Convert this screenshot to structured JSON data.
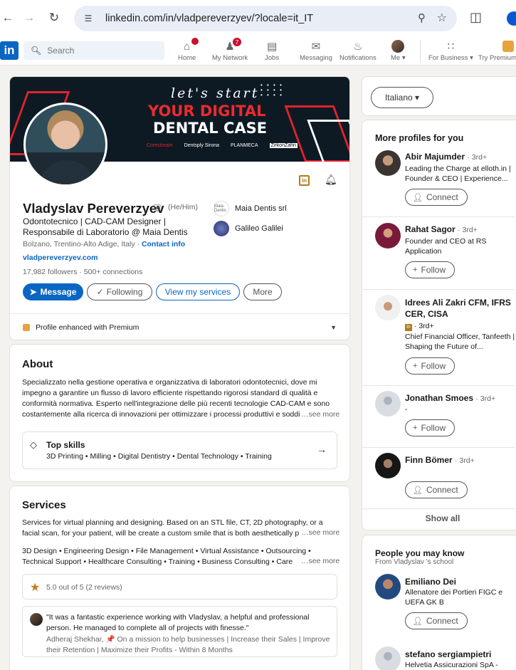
{
  "browser": {
    "url": "linkedin.com/in/vladpereverzyev/?locale=it_IT"
  },
  "nav": {
    "logo": "in",
    "search_placeholder": "Search",
    "items": [
      {
        "label": "Home",
        "badge": ""
      },
      {
        "label": "My Network",
        "badge": "7"
      },
      {
        "label": "Jobs",
        "badge": ""
      },
      {
        "label": "Messaging",
        "badge": ""
      },
      {
        "label": "Notifications",
        "badge": ""
      },
      {
        "label": "Me ▾",
        "badge": ""
      },
      {
        "label": "For Business ▾",
        "badge": ""
      },
      {
        "label": "Try Premium",
        "badge": ""
      }
    ]
  },
  "banner": {
    "tagline": "let's start",
    "title_line1": "YOUR DIGITAL",
    "title_line2": "DENTAL CASE",
    "sponsors": [
      "Corestream",
      "Dentsply Sirona",
      "PLANMECA",
      "ZirkonZahn"
    ]
  },
  "profile": {
    "name": "Vladyslav Pereverzyev",
    "pronouns": "(He/Him)",
    "headline": "Odontotecnico | CAD-CAM Designer | Responsabile di Laboratorio @ Maia Dentis",
    "location": "Bolzano, Trentino-Alto Adige, Italy · ",
    "contact_info": "Contact info",
    "website": "vladpereverzyev.com",
    "stats": "17,982 followers · 500+ connections",
    "orgs": [
      {
        "logo_text": "Maia Dentis",
        "name": "Maia Dentis srl"
      },
      {
        "logo_text": "",
        "name": "Galileo Galilei"
      }
    ],
    "buttons": {
      "message": "Message",
      "following": "Following",
      "services": "View my services",
      "more": "More"
    },
    "premium_note": "Profile enhanced with Premium"
  },
  "about": {
    "title": "About",
    "text": "Specializzato nella gestione operativa e organizzativa di laboratori odontotecnici, dove mi impegno a garantire un flusso di lavoro efficiente rispettando rigorosi standard di qualità e conformità normativa. Esperto nell'integrazione delle più recenti tecnologie CAD-CAM e sono costantemente alla ricerca di innovazioni per ottimizzare i processi produttivi e soddi",
    "see_more": "…see more",
    "top_skills_title": "Top skills",
    "top_skills": "3D Printing • Milling • Digital Dentistry • Dental Technology • Training"
  },
  "services": {
    "title": "Services",
    "text": "Services for virtual planning and designing. Based on an STL file, CT, 2D photography, or a facial scan, for your patient, will be create a custom smile that is both aesthetically p",
    "see_more": "…see more",
    "list": "3D Design • Engineering Design • File Management • Virtual Assistance • Outsourcing • Technical Support • Healthcare Consulting • Training • Business Consulting • Care",
    "list_see_more": "…see more",
    "rating": "5.0 out of 5 (2 reviews)",
    "review_quote": "\"It was a fantastic experience working with Vladyslav, a helpful and professional person. He managed to complete all of projects with finesse.\"",
    "reviewer": "Adheraj Shekhar, 📌 On a mission to help businesses | Increase their Sales | Improve their Retention | Maximize their Profits - Within 8 Months"
  },
  "sidebar": {
    "language": "Italiano ▾",
    "more_profiles_title": "More profiles for you",
    "profiles": [
      {
        "name": "Abir Majumder",
        "degree": "· 3rd+",
        "headline": "Leading the Charge at elloth.in | Founder & CEO | Experience...",
        "action": "Connect"
      },
      {
        "name": "Rahat Sagor",
        "degree": "· 3rd+",
        "headline": "Founder and CEO at RS Application",
        "action": "Follow"
      },
      {
        "name": "Idrees Ali Zakri CFM, IFRS CER, CISA",
        "degree": "· 3rd+",
        "headline": "Chief Financial Officer, Tanfeeth | Shaping the Future of...",
        "action": "Follow"
      },
      {
        "name": "Jonathan Smoes",
        "degree": "· 3rd+",
        "headline": "-",
        "action": "Follow"
      },
      {
        "name": "Finn Bömer",
        "degree": "· 3rd+",
        "headline": "",
        "action": "Connect"
      }
    ],
    "show_all": "Show all",
    "pymk_title": "People you may know",
    "pymk_sub": "From Vladyslav 's school",
    "pymk": [
      {
        "name": "Emiliano Dei",
        "headline": "Allenatore dei Portieri FIGC e UEFA GK B",
        "action": "Connect"
      },
      {
        "name": "stefano sergiampietri",
        "headline": "Helvetia Assicurazioni SpA -",
        "action": ""
      }
    ]
  },
  "colors": {
    "brand": "#0a66c2",
    "premium": "#e7a33e",
    "badge": "#cb112d"
  }
}
